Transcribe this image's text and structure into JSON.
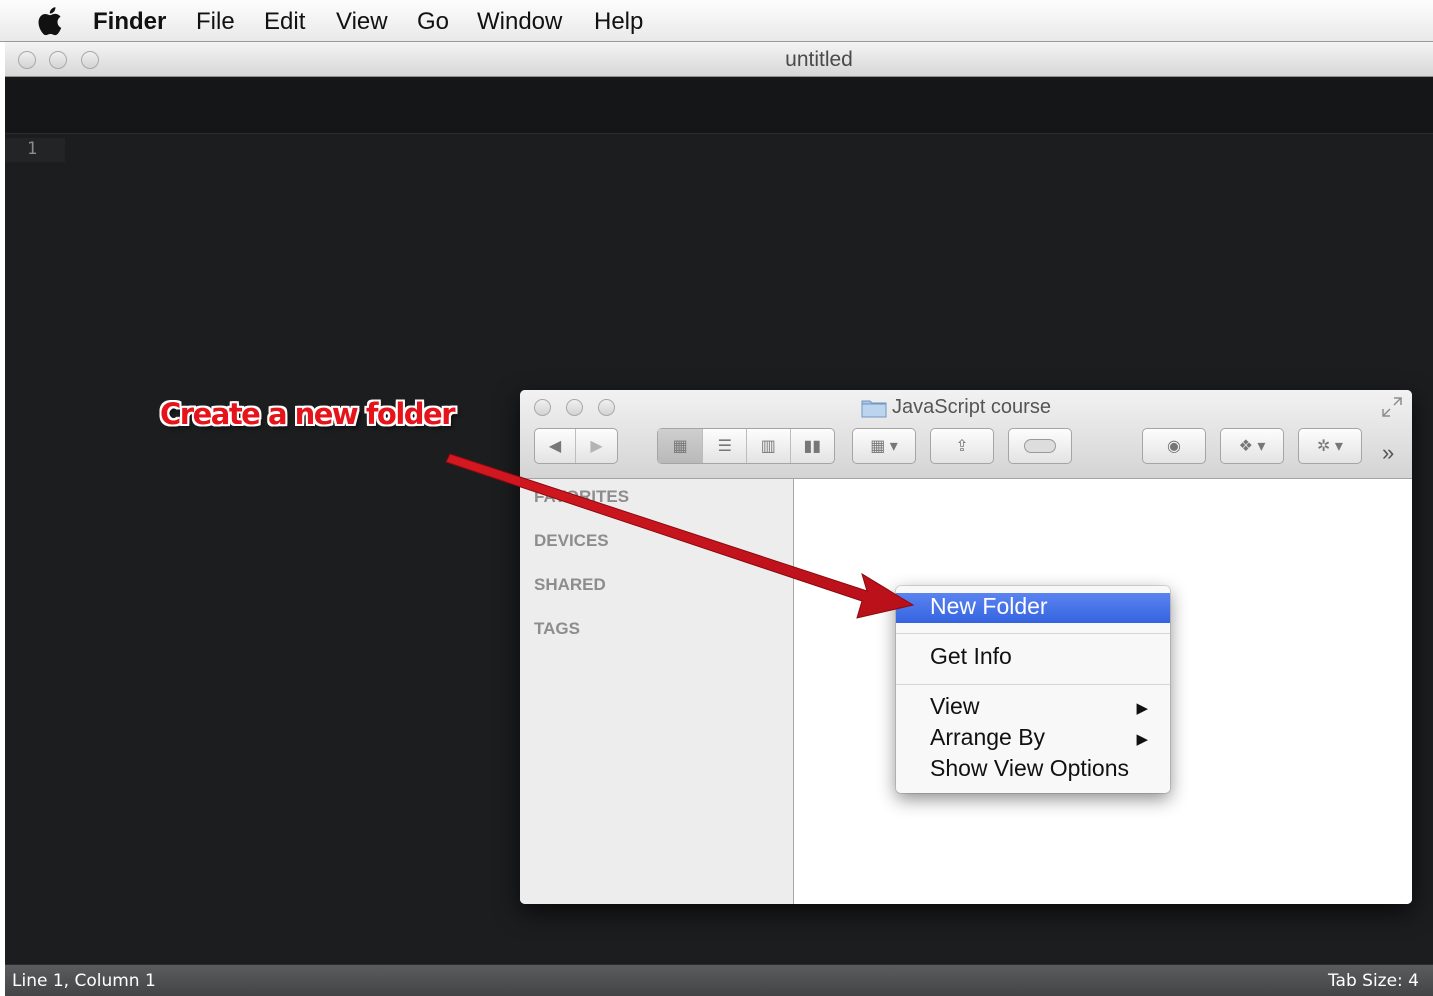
{
  "menubar": {
    "app": "Finder",
    "items": [
      "File",
      "Edit",
      "View",
      "Go",
      "Window",
      "Help"
    ]
  },
  "editor": {
    "title": "untitled",
    "line_number": "1",
    "status_left": "Line 1, Column 1",
    "status_right": "Tab Size: 4"
  },
  "annotation": {
    "text": "Create a new folder",
    "color": "#e5131a"
  },
  "finder": {
    "title": "JavaScript course",
    "sidebar_sections": [
      "FAVORITES",
      "DEVICES",
      "SHARED",
      "TAGS"
    ]
  },
  "context_menu": {
    "items": [
      {
        "label": "New Folder",
        "highlighted": true
      },
      {
        "label": "Get Info"
      },
      {
        "label": "View",
        "submenu": true
      },
      {
        "label": "Arrange By",
        "submenu": true
      },
      {
        "label": "Show View Options"
      }
    ],
    "highlight_color": "#3d6ce6"
  }
}
